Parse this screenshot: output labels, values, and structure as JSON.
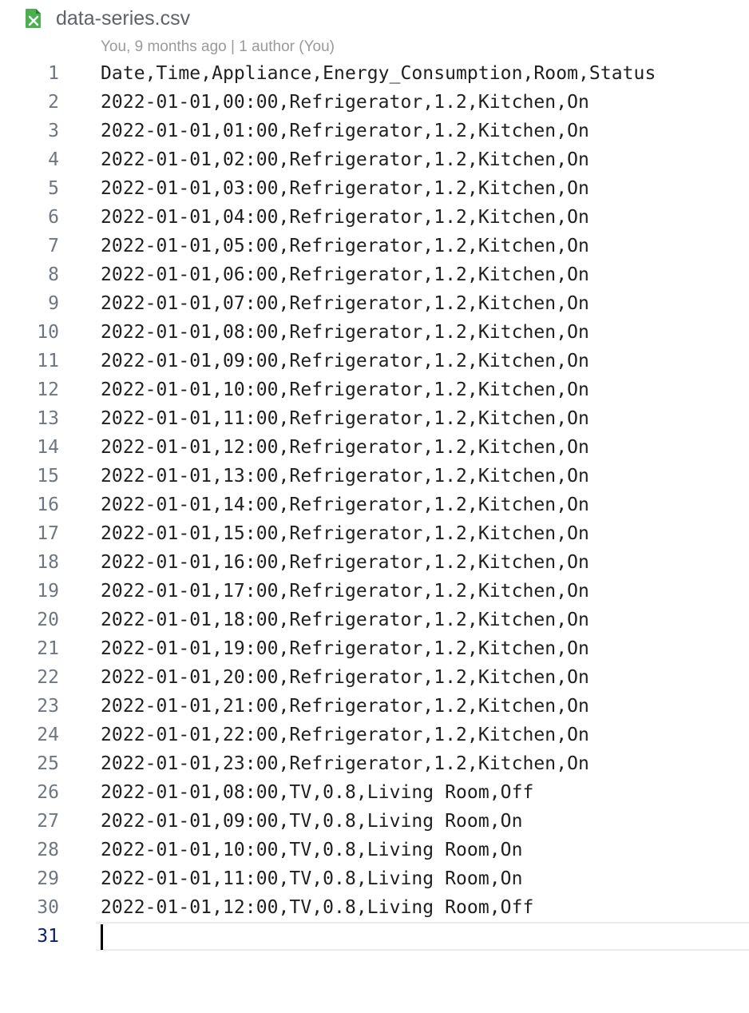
{
  "tab": {
    "file_name": "data-series.csv",
    "file_icon": "csv-file-icon",
    "icon_color": "#4caf50"
  },
  "blame": "You, 9 months ago | 1 author (You)",
  "editor": {
    "current_line": 31,
    "lines": [
      {
        "n": "1",
        "text": "Date,Time,Appliance,Energy_Consumption,Room,Status"
      },
      {
        "n": "2",
        "text": "2022-01-01,00:00,Refrigerator,1.2,Kitchen,On"
      },
      {
        "n": "3",
        "text": "2022-01-01,01:00,Refrigerator,1.2,Kitchen,On"
      },
      {
        "n": "4",
        "text": "2022-01-01,02:00,Refrigerator,1.2,Kitchen,On"
      },
      {
        "n": "5",
        "text": "2022-01-01,03:00,Refrigerator,1.2,Kitchen,On"
      },
      {
        "n": "6",
        "text": "2022-01-01,04:00,Refrigerator,1.2,Kitchen,On"
      },
      {
        "n": "7",
        "text": "2022-01-01,05:00,Refrigerator,1.2,Kitchen,On"
      },
      {
        "n": "8",
        "text": "2022-01-01,06:00,Refrigerator,1.2,Kitchen,On"
      },
      {
        "n": "9",
        "text": "2022-01-01,07:00,Refrigerator,1.2,Kitchen,On"
      },
      {
        "n": "10",
        "text": "2022-01-01,08:00,Refrigerator,1.2,Kitchen,On"
      },
      {
        "n": "11",
        "text": "2022-01-01,09:00,Refrigerator,1.2,Kitchen,On"
      },
      {
        "n": "12",
        "text": "2022-01-01,10:00,Refrigerator,1.2,Kitchen,On"
      },
      {
        "n": "13",
        "text": "2022-01-01,11:00,Refrigerator,1.2,Kitchen,On"
      },
      {
        "n": "14",
        "text": "2022-01-01,12:00,Refrigerator,1.2,Kitchen,On"
      },
      {
        "n": "15",
        "text": "2022-01-01,13:00,Refrigerator,1.2,Kitchen,On"
      },
      {
        "n": "16",
        "text": "2022-01-01,14:00,Refrigerator,1.2,Kitchen,On"
      },
      {
        "n": "17",
        "text": "2022-01-01,15:00,Refrigerator,1.2,Kitchen,On"
      },
      {
        "n": "18",
        "text": "2022-01-01,16:00,Refrigerator,1.2,Kitchen,On"
      },
      {
        "n": "19",
        "text": "2022-01-01,17:00,Refrigerator,1.2,Kitchen,On"
      },
      {
        "n": "20",
        "text": "2022-01-01,18:00,Refrigerator,1.2,Kitchen,On"
      },
      {
        "n": "21",
        "text": "2022-01-01,19:00,Refrigerator,1.2,Kitchen,On"
      },
      {
        "n": "22",
        "text": "2022-01-01,20:00,Refrigerator,1.2,Kitchen,On"
      },
      {
        "n": "23",
        "text": "2022-01-01,21:00,Refrigerator,1.2,Kitchen,On"
      },
      {
        "n": "24",
        "text": "2022-01-01,22:00,Refrigerator,1.2,Kitchen,On"
      },
      {
        "n": "25",
        "text": "2022-01-01,23:00,Refrigerator,1.2,Kitchen,On"
      },
      {
        "n": "26",
        "text": "2022-01-01,08:00,TV,0.8,Living Room,Off"
      },
      {
        "n": "27",
        "text": "2022-01-01,09:00,TV,0.8,Living Room,On"
      },
      {
        "n": "28",
        "text": "2022-01-01,10:00,TV,0.8,Living Room,On"
      },
      {
        "n": "29",
        "text": "2022-01-01,11:00,TV,0.8,Living Room,On"
      },
      {
        "n": "30",
        "text": "2022-01-01,12:00,TV,0.8,Living Room,Off"
      },
      {
        "n": "31",
        "text": ""
      }
    ]
  }
}
